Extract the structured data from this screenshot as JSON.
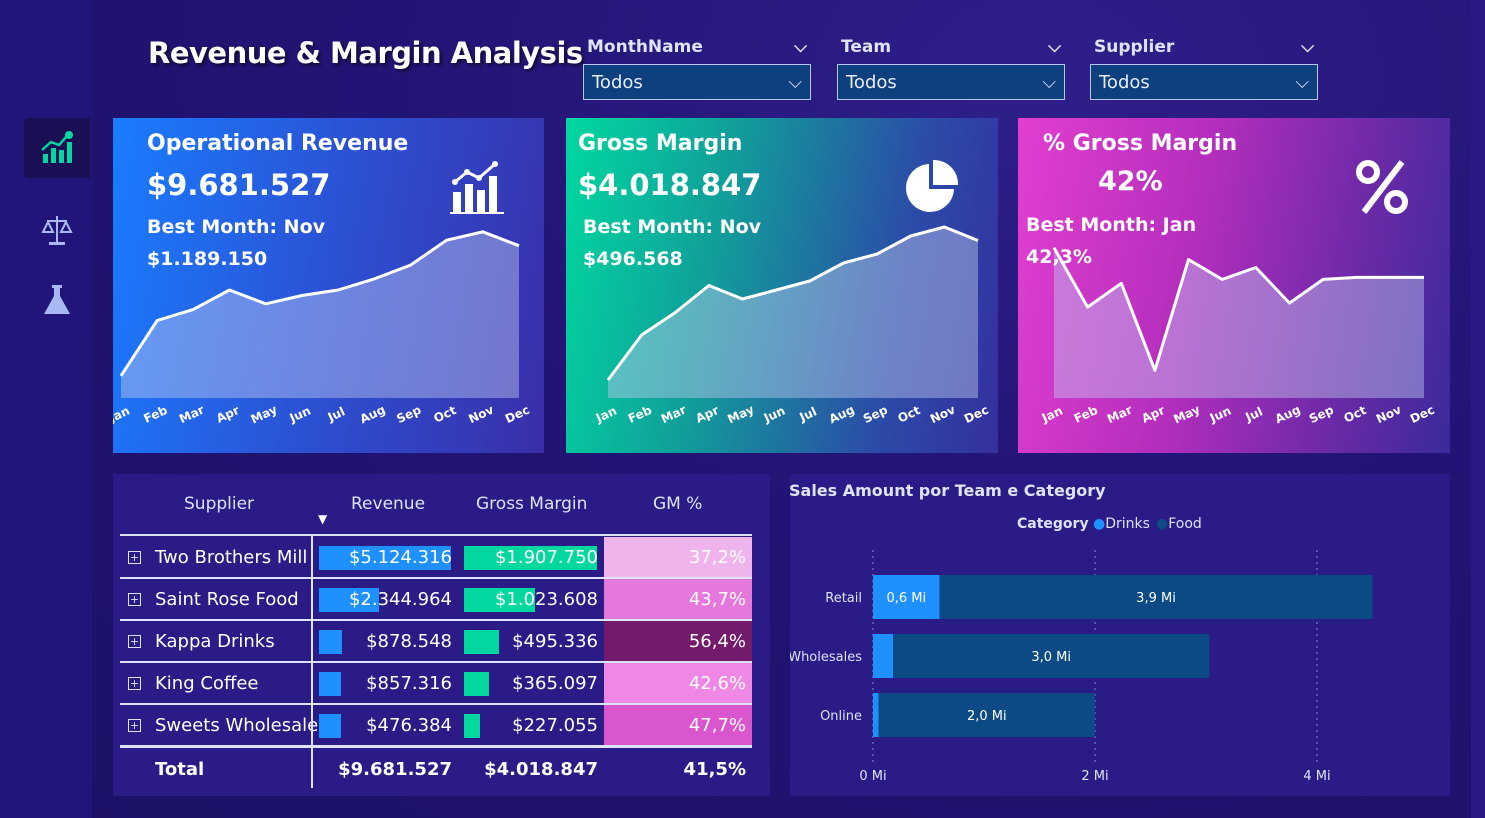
{
  "title": "Revenue & Margin Analysis",
  "colors": {
    "accent_blue": "#1e90ff",
    "accent_green": "#00d8a0",
    "accent_pink": "#e040c8",
    "navy_bar": "#0b4a85"
  },
  "filters": [
    {
      "label": "MonthName",
      "value": "Todos"
    },
    {
      "label": "Team",
      "value": "Todos"
    },
    {
      "label": "Supplier",
      "value": "Todos"
    }
  ],
  "sidebar": {
    "icons": [
      "bar-chart-money-icon",
      "scale-icon",
      "flask-icon"
    ]
  },
  "months": [
    "Jan",
    "Feb",
    "Mar",
    "Apr",
    "May",
    "Jun",
    "Jul",
    "Aug",
    "Sep",
    "Oct",
    "Nov",
    "Dec"
  ],
  "cards": [
    {
      "title": "Operational Revenue",
      "value": "$9.681.527",
      "best_label": "Best Month: Nov",
      "best_value": "$1.189.150",
      "icon": "chart-up-icon",
      "series": [
        0.38,
        0.58,
        0.62,
        0.69,
        0.64,
        0.67,
        0.69,
        0.73,
        0.78,
        0.87,
        0.9,
        0.85
      ]
    },
    {
      "title": "Gross Margin",
      "value": "$4.018.847",
      "best_label": "Best Month: Nov",
      "best_value": "$496.568",
      "icon": "pie-chart-icon",
      "series": [
        0.16,
        0.26,
        0.31,
        0.37,
        0.34,
        0.36,
        0.38,
        0.42,
        0.44,
        0.48,
        0.5,
        0.47
      ]
    },
    {
      "title": "% Gross Margin",
      "value": "42%",
      "best_label": "Best Month: Jan",
      "best_value": "42,3%",
      "icon": "percent-icon",
      "series": [
        42.3,
        40.8,
        41.4,
        39.2,
        42.0,
        41.5,
        41.8,
        40.9,
        41.5,
        41.55,
        41.55,
        41.55
      ]
    }
  ],
  "table": {
    "headers": [
      "Supplier",
      "Revenue",
      "Gross Margin",
      "GM %"
    ],
    "rows": [
      {
        "supplier": "Two Brothers Mill",
        "revenue": "$5.124.316",
        "revenue_num": 5124316,
        "margin": "$1.907.750",
        "margin_num": 1907750,
        "gm": "37,2%",
        "gm_num": 37.2
      },
      {
        "supplier": "Saint Rose Food",
        "revenue": "$2.344.964",
        "revenue_num": 2344964,
        "margin": "$1.023.608",
        "margin_num": 1023608,
        "gm": "43,7%",
        "gm_num": 43.7
      },
      {
        "supplier": "Kappa Drinks",
        "revenue": "$878.548",
        "revenue_num": 878548,
        "margin": "$495.336",
        "margin_num": 495336,
        "gm": "56,4%",
        "gm_num": 56.4
      },
      {
        "supplier": "King Coffee",
        "revenue": "$857.316",
        "revenue_num": 857316,
        "margin": "$365.097",
        "margin_num": 365097,
        "gm": "42,6%",
        "gm_num": 42.6
      },
      {
        "supplier": "Sweets Wholesale",
        "revenue": "$476.384",
        "revenue_num": 476384,
        "margin": "$227.055",
        "margin_num": 227055,
        "gm": "47,7%",
        "gm_num": 47.7
      }
    ],
    "total": {
      "label": "Total",
      "revenue": "$9.681.527",
      "margin": "$4.018.847",
      "gm": "41,5%"
    }
  },
  "chart_data": {
    "type": "bar",
    "title": "Sales Amount por Team e Category",
    "legend_title": "Category",
    "legend": "top-center",
    "categories": [
      "Retail",
      "Wholesales",
      "Online"
    ],
    "series": [
      {
        "name": "Drinks",
        "values": [
          0.6,
          0.18,
          0.05
        ],
        "labels": [
          "0,6 Mi",
          "",
          ""
        ],
        "color": "#1e90ff"
      },
      {
        "name": "Food",
        "values": [
          3.9,
          2.85,
          1.95
        ],
        "labels": [
          "3,9 Mi",
          "3,0 Mi",
          "2,0 Mi"
        ],
        "color": "#0b4a85"
      }
    ],
    "xticks": [
      "0 Mi",
      "2 Mi",
      "4 Mi"
    ],
    "xlim": [
      0,
      4.5
    ],
    "stacked": true,
    "orientation": "horizontal"
  }
}
